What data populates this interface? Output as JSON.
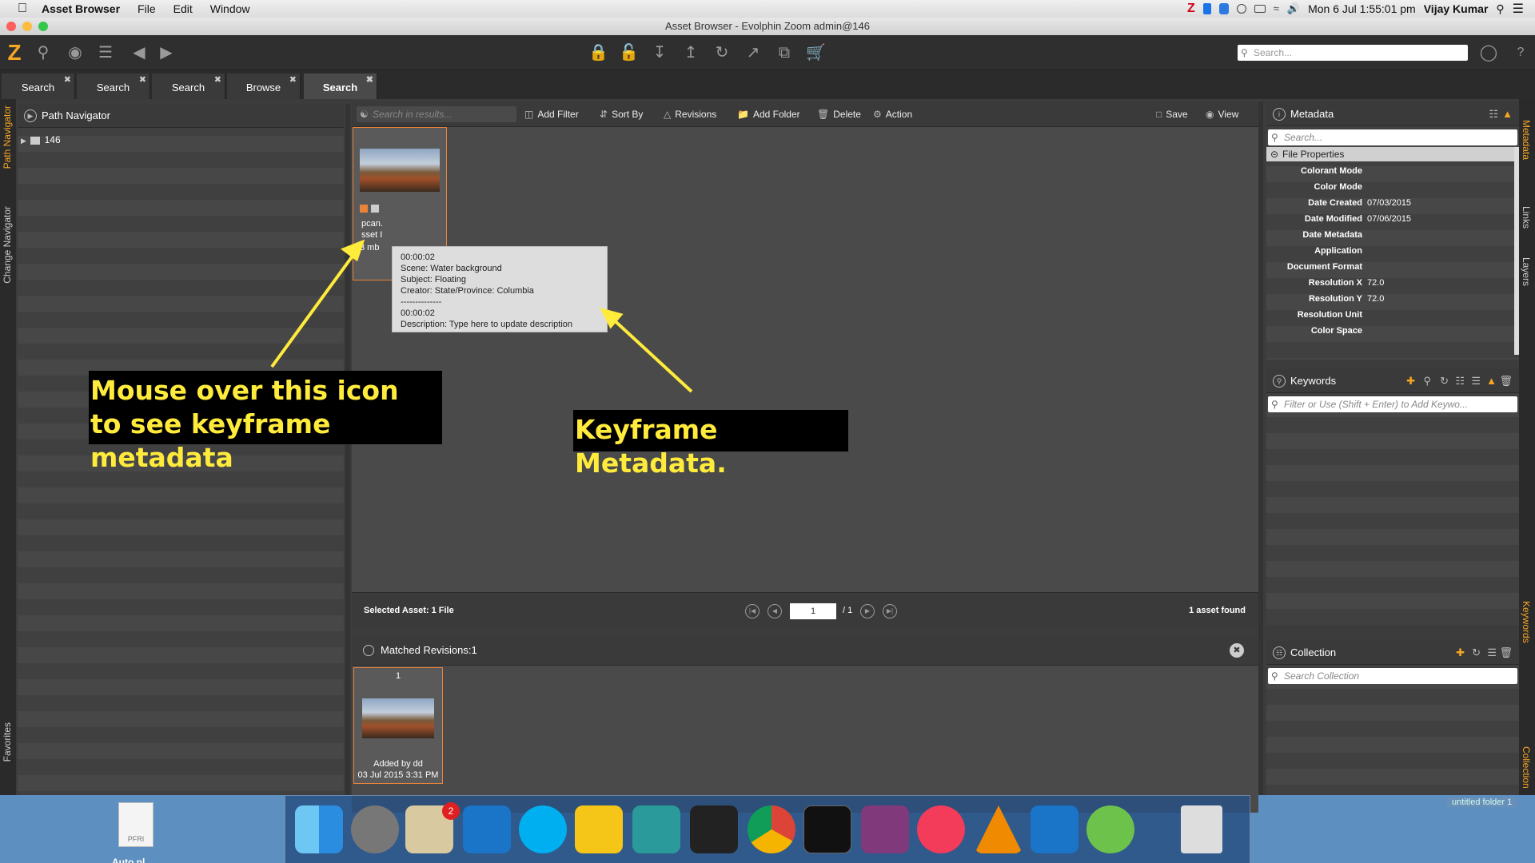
{
  "menubar": {
    "app_name": "Asset Browser",
    "menus": [
      "File",
      "Edit",
      "Window"
    ],
    "clock": "Mon 6 Jul  1:55:01 pm",
    "user": "Vijay Kumar"
  },
  "window": {
    "title": "Asset Browser - Evolphin Zoom admin@146"
  },
  "toolbar": {
    "search_placeholder": "Search..."
  },
  "tabs": [
    {
      "label": "Search"
    },
    {
      "label": "Search"
    },
    {
      "label": "Search"
    },
    {
      "label": "Browse"
    },
    {
      "label": "Search"
    }
  ],
  "left_strip": {
    "path_navigator": "Path Navigator",
    "change_navigator": "Change Navigator",
    "favorites": "Favorites"
  },
  "path_navigator": {
    "title": "Path Navigator",
    "root_item": "146"
  },
  "center_toolbar": {
    "search_placeholder": "Search in results...",
    "add_filter": "Add Filter",
    "sort_by": "Sort By",
    "revisions": "Revisions",
    "add_folder": "Add Folder",
    "delete": "Delete",
    "action": "Action",
    "save": "Save",
    "view": "View"
  },
  "asset_card": {
    "name_fragment": "pcan.",
    "id_fragment": "sset I",
    "size": "3 mb"
  },
  "tooltip": {
    "line1": "00:00:02",
    "line2": "Scene: Water background",
    "line3": "Subject: Floating",
    "line4": "Creator: State/Province: Columbia",
    "line5": "--------------",
    "line6": "00:00:02",
    "line7": "Description: Type here to update description"
  },
  "callouts": {
    "left_line1": "Mouse over this icon",
    "left_line2": "to see keyframe metadata",
    "right": "Keyframe Metadata."
  },
  "status_bar": {
    "selected": "Selected Asset: 1 File",
    "page_value": "1",
    "page_total": "/ 1",
    "found": "1 asset found"
  },
  "matched": {
    "title": "Matched Revisions:1",
    "rev_number": "1",
    "added_by": "Added by dd",
    "date": "03 Jul 2015 3:31 PM"
  },
  "metadata": {
    "title": "Metadata",
    "search_placeholder": "Search...",
    "section": "File Properties",
    "rows": [
      {
        "k": "Colorant Mode",
        "v": ""
      },
      {
        "k": "Color Mode",
        "v": ""
      },
      {
        "k": "Date Created",
        "v": "07/03/2015"
      },
      {
        "k": "Date Modified",
        "v": "07/06/2015"
      },
      {
        "k": "Date Metadata",
        "v": ""
      },
      {
        "k": "Application",
        "v": ""
      },
      {
        "k": "Document Format",
        "v": ""
      },
      {
        "k": "Resolution X",
        "v": "72.0"
      },
      {
        "k": "Resolution Y",
        "v": "72.0"
      },
      {
        "k": "Resolution Unit",
        "v": ""
      },
      {
        "k": "Color Space",
        "v": ""
      }
    ]
  },
  "keywords": {
    "title": "Keywords",
    "placeholder": "Filter or Use (Shift + Enter) to Add Keywo..."
  },
  "collection": {
    "title": "Collection",
    "placeholder": "Search Collection"
  },
  "right_strip": {
    "metadata": "Metadata",
    "links": "Links",
    "layers": "Layers",
    "keywords": "Keywords",
    "collection": "Collection"
  },
  "desktop": {
    "file_label": "PFRI",
    "file_name": "Auto.pl",
    "folder_label": "untitled folder 1"
  },
  "dock": {
    "mail_badge": "2"
  }
}
